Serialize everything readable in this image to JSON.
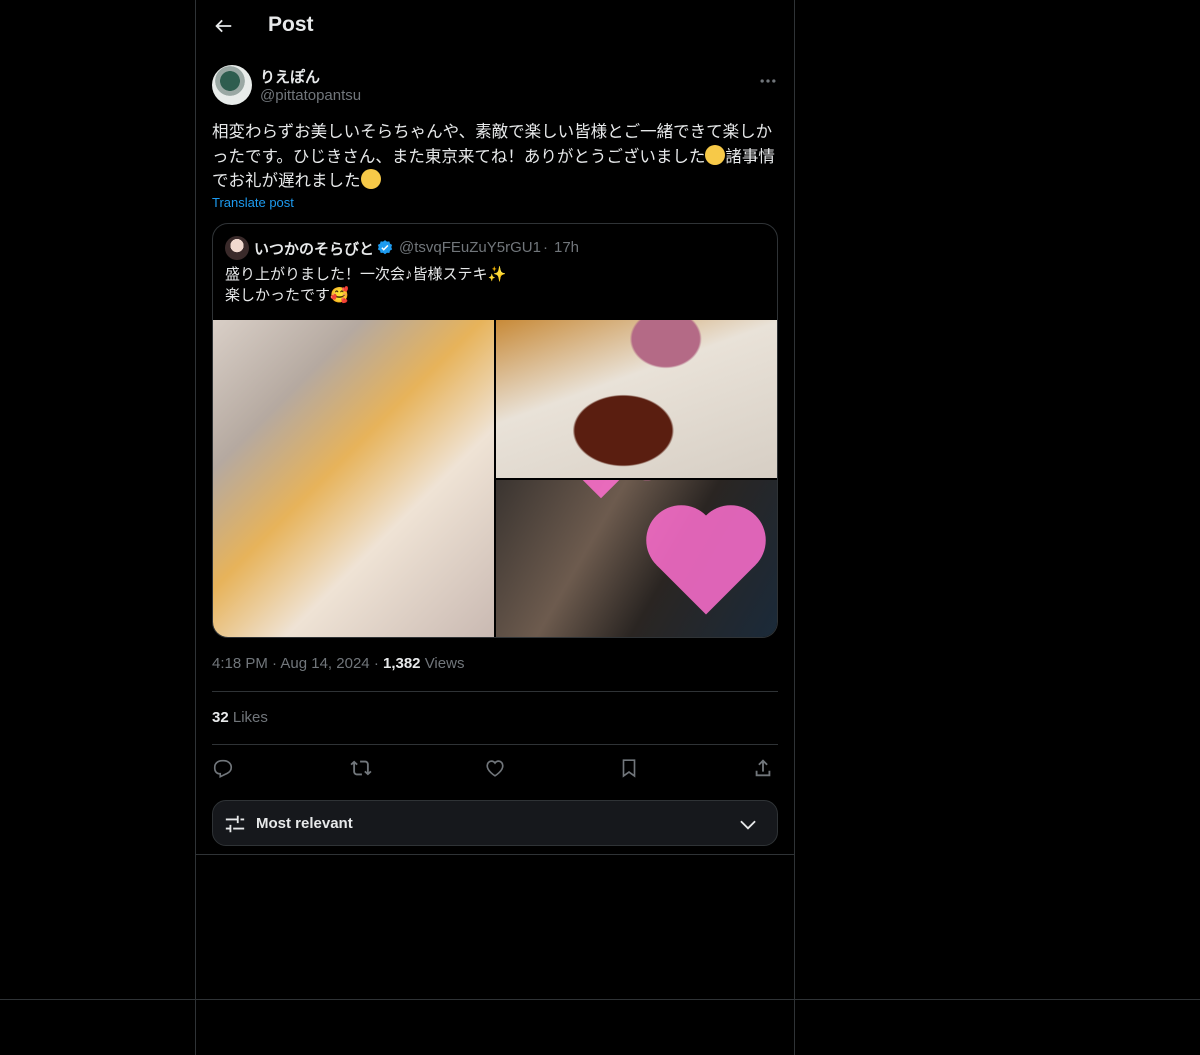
{
  "header": {
    "title": "Post"
  },
  "author": {
    "name": "りえぽん",
    "handle": "@pittatopantsu"
  },
  "post": {
    "text_1": "相変わらずお美しいそらちゃんや、素敵で楽しい皆様とご一緒できて楽しかったです。ひじきさん、また東京来てね！ありがとうございました",
    "text_2": "諸事情でお礼が遅れました",
    "translate_label": "Translate post"
  },
  "quote": {
    "name": "いつかのそらびと",
    "handle": "@tsvqFEuZuY5rGU1",
    "separator": "·",
    "time": "17h",
    "line_1": "盛り上がりました！一次会♪皆様ステキ✨",
    "line_2": "楽しかったです🥰"
  },
  "meta": {
    "time": "4:18 PM",
    "dot": "·",
    "date": "Aug 14, 2024",
    "views_count": "1,382",
    "views_label": "Views"
  },
  "stats": {
    "likes_count": "32",
    "likes_label": "Likes"
  },
  "sort": {
    "label": "Most relevant"
  },
  "colors": {
    "accent": "#1d9bf0",
    "background": "#000000",
    "border": "#2f3336",
    "muted": "#71767b"
  },
  "icons": [
    "back-arrow-icon",
    "more-icon",
    "verified-badge-icon",
    "reply-icon",
    "repost-icon",
    "like-icon",
    "bookmark-icon",
    "share-icon",
    "sort-sliders-icon",
    "chevron-down-icon"
  ]
}
